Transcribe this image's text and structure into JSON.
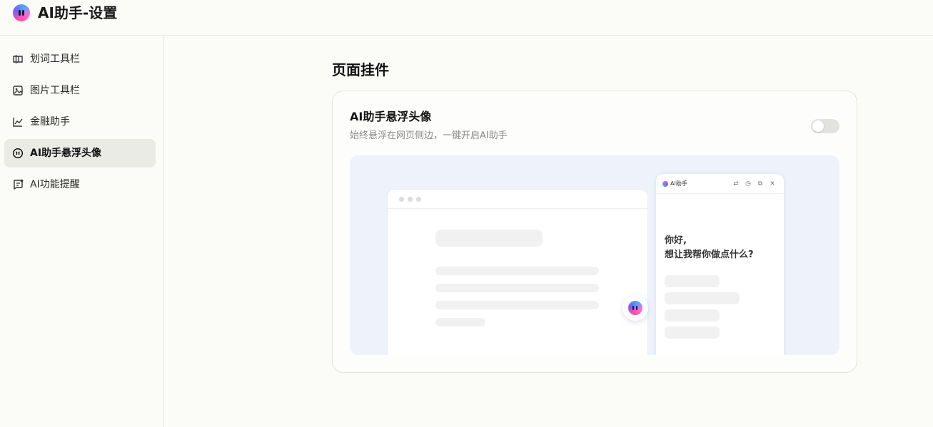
{
  "header": {
    "title": "AI助手-设置"
  },
  "sidebar": {
    "items": [
      {
        "label": "划词工具栏",
        "icon": "text-select-icon",
        "active": false
      },
      {
        "label": "图片工具栏",
        "icon": "image-icon",
        "active": false
      },
      {
        "label": "金融助手",
        "icon": "chart-line-icon",
        "active": false
      },
      {
        "label": "AI助手悬浮头像",
        "icon": "floating-avatar-icon",
        "active": true
      },
      {
        "label": "AI功能提醒",
        "icon": "reminder-icon",
        "active": false
      }
    ]
  },
  "main": {
    "section_title": "页面挂件",
    "card": {
      "title": "AI助手悬浮头像",
      "description": "始终悬浮在网页侧边，一键开启AI助手",
      "toggle_on": false
    },
    "preview": {
      "panel_title": "AI助手",
      "greeting_line1": "你好,",
      "greeting_line2": "想让我帮你做点什么?"
    }
  },
  "colors": {
    "background": "#fbfbf7",
    "active_item_bg": "#ebebe6",
    "preview_bg": "#eef3fb",
    "toggle_off": "#e2e2df"
  }
}
